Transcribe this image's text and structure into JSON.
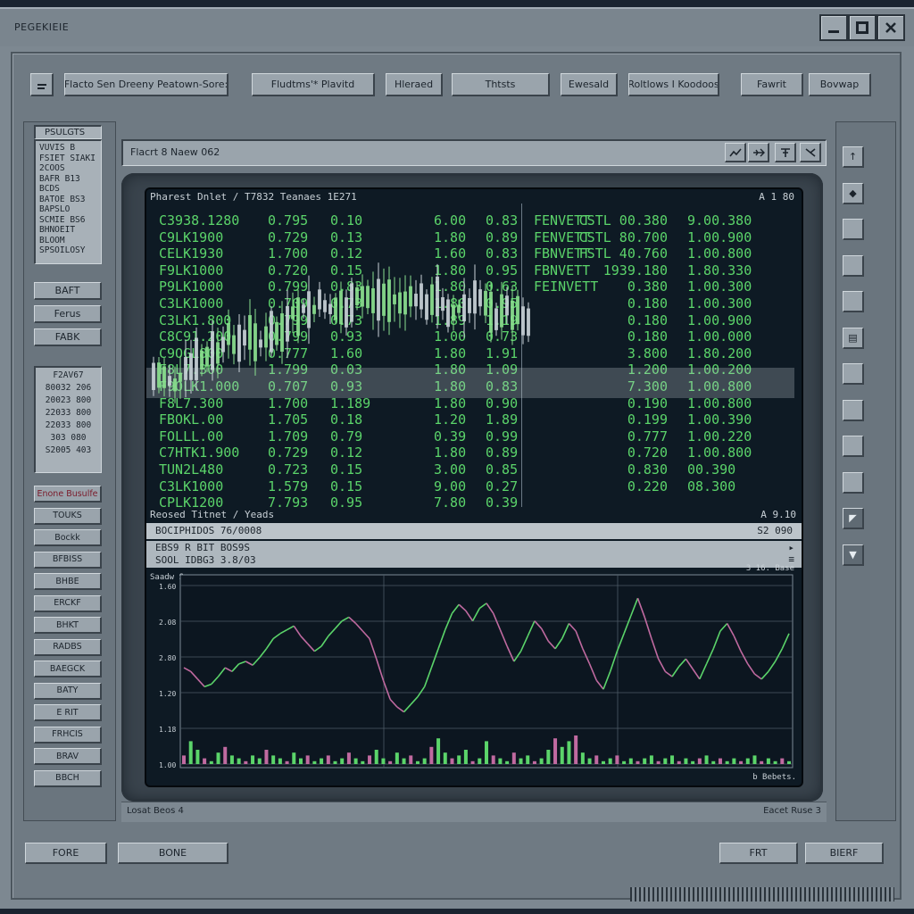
{
  "window": {
    "title": "PEGEKIEIE",
    "controls": [
      "minimize-icon",
      "maximize-icon",
      "close-icon"
    ]
  },
  "toolbar": {
    "icon_button": "menu-icon",
    "buttons": [
      "Flacto Sen Dreeny Peatown-Sore:",
      "Fludtms'* Plavitd",
      "Hleraed",
      "Thtsts",
      "Ewesald",
      "Roltlows I Koodoos",
      "Fawrit",
      "Bovwap"
    ]
  },
  "left_panel": {
    "list_title": "PSULGTS",
    "list_lines": [
      "VUVIS  B",
      "FSIET  SIAKI",
      "2COOS",
      "BAFR  B13",
      "BCDS",
      "BATOE  BS3",
      "BAPSLO",
      "SCMIE  BS6",
      "BHNOEIT",
      "BLOOM",
      "SPSOILOSY"
    ],
    "buttons_a": [
      "BAFT",
      "Ferus",
      "FABK"
    ],
    "value_title": "F2AV67",
    "value_lines": [
      "80032  206",
      "20023  800",
      "22033  800",
      "22033  800",
      "303  080",
      "S2005  403"
    ],
    "buttons_b": [
      "Enone Busulfe",
      "TOUKS",
      "Bockk",
      "BFBISS",
      "BHBE",
      "ERCKF",
      "BHKT",
      "RADBS",
      "BAEGCK",
      "BATY",
      "E RIT",
      "FRHCIS",
      "BRAV",
      "BBCH"
    ]
  },
  "right_panel": {
    "buttons": [
      "up-icon",
      "tag-icon",
      "blank",
      "blank",
      "blank",
      "doc-icon",
      "blank",
      "blank",
      "blank",
      "blank",
      "arrow-icon",
      "pin-icon"
    ]
  },
  "inner_toolbar": {
    "text": "Flacrt 8 Naew 062",
    "icons": [
      "chart-icon",
      "plane-icon",
      "pin-tool-icon",
      "mark-icon"
    ]
  },
  "screen_header": {
    "left": "Pharest Dnlet / T7832 Teanaes 1E271",
    "right": "A 1 80"
  },
  "left_table": [
    [
      "C3938.1280",
      "0.795",
      "0.10",
      "6.00",
      "0.83"
    ],
    [
      "C9LK1900",
      "0.729",
      "0.13",
      "1.80",
      "0.89"
    ],
    [
      "CELK1930",
      "1.700",
      "0.12",
      "1.60",
      "0.83"
    ],
    [
      "F9LK1000",
      "0.720",
      "0.15",
      "1.80",
      "0.95"
    ],
    [
      "P9LK1000",
      "0.799",
      "0.83",
      "1.80",
      "0.63"
    ],
    [
      "C3LK1000",
      "0.709",
      "0.73",
      "1.80",
      "0.95"
    ],
    [
      "C3LK1.800",
      "0.799",
      "0.73",
      "1.89",
      "1.19"
    ],
    [
      "C8C91.200",
      "0.799",
      "0.93",
      "1.00",
      "0.73"
    ],
    [
      "C9OGL800",
      "0.777",
      "1.60",
      "1.80",
      "1.91"
    ],
    [
      "F8L7.300",
      "1.799",
      "0.03",
      "1.80",
      "1.09"
    ],
    [
      "F9OLK1.000",
      "0.707",
      "0.93",
      "1.80",
      "0.83"
    ],
    [
      "F8L7.300",
      "1.700",
      "1.189",
      "1.80",
      "0.90"
    ],
    [
      "FBOKL.00",
      "1.705",
      "0.18",
      "1.20",
      "1.89"
    ],
    [
      "FOLLL.00",
      "1.709",
      "0.79",
      "0.39",
      "0.99"
    ],
    [
      "C7HTK1.900",
      "0.729",
      "0.12",
      "1.80",
      "0.89"
    ],
    [
      "TUN2L480",
      "0.723",
      "0.15",
      "3.00",
      "0.85"
    ],
    [
      "C3LK1000",
      "1.579",
      "0.15",
      "9.00",
      "0.27"
    ],
    [
      "CPLK1200",
      "7.793",
      "0.95",
      "7.80",
      "0.39"
    ]
  ],
  "right_table": [
    [
      "FENVETT",
      "CSTL 00.380",
      "9.00.380"
    ],
    [
      "FENVETT",
      "CSTL 80.700",
      "1.00.900"
    ],
    [
      "FBNVETT",
      "FSTL 40.760",
      "1.00.800"
    ],
    [
      "FBNVETT",
      "1939.180",
      "1.80.330"
    ],
    [
      "FEINVETT",
      "0.380",
      "1.00.300"
    ],
    [
      "",
      "0.180",
      "1.00.300"
    ],
    [
      "",
      "0.180",
      "1.00.900"
    ],
    [
      "",
      "0.180",
      "1.00.000"
    ],
    [
      "",
      "3.800",
      "1.80.200"
    ],
    [
      "",
      "1.200",
      "1.00.200"
    ],
    [
      "",
      "7.300",
      "1.00.800"
    ],
    [
      "",
      "0.190",
      "1.00.800"
    ],
    [
      "",
      "0.199",
      "1.00.390"
    ],
    [
      "",
      "0.777",
      "1.00.220"
    ],
    [
      "",
      "0.720",
      "1.00.800"
    ],
    [
      "",
      "0.830",
      "00.390"
    ],
    [
      "",
      "0.220",
      "08.300"
    ]
  ],
  "lower": {
    "title": "Reosed Titnet / Yeads",
    "title_right": "A 9.10",
    "row1_left": "BOCIPHIDOS  76/0008",
    "row1_right": "S2 090",
    "row2": "EBS9 R  BIT    BOS9S",
    "row3": "SOOL IDBG3    3.8/03",
    "chart_corner_left": "Saadw Sase",
    "chart_corner_right": "3 16. Base",
    "footer_right": "b Bebets."
  },
  "status": {
    "left": "Losat Beos 4",
    "right": "Eacet Ruse 3"
  },
  "bottom_buttons": {
    "left": [
      "FORE",
      "BONE"
    ],
    "right": [
      "FRT",
      "BIERF"
    ]
  },
  "chart_data": {
    "type": "line",
    "title": "",
    "ylabel": "",
    "y_ticks": [
      "1.60",
      "2.08",
      "2.80",
      "1.20",
      "1.18",
      "1.00"
    ],
    "values": [
      1.55,
      1.52,
      1.46,
      1.4,
      1.42,
      1.48,
      1.55,
      1.52,
      1.58,
      1.6,
      1.57,
      1.63,
      1.7,
      1.78,
      1.82,
      1.85,
      1.88,
      1.8,
      1.74,
      1.68,
      1.72,
      1.8,
      1.86,
      1.92,
      1.95,
      1.9,
      1.84,
      1.78,
      1.62,
      1.45,
      1.3,
      1.24,
      1.2,
      1.26,
      1.32,
      1.4,
      1.55,
      1.7,
      1.85,
      1.98,
      2.05,
      2.0,
      1.92,
      2.02,
      2.06,
      1.98,
      1.85,
      1.72,
      1.6,
      1.68,
      1.8,
      1.92,
      1.86,
      1.76,
      1.7,
      1.78,
      1.9,
      1.84,
      1.7,
      1.58,
      1.45,
      1.38,
      1.52,
      1.68,
      1.82,
      1.96,
      2.1,
      1.95,
      1.78,
      1.62,
      1.52,
      1.48,
      1.56,
      1.62,
      1.54,
      1.46,
      1.58,
      1.7,
      1.84,
      1.9,
      1.8,
      1.68,
      1.58,
      1.5,
      1.46,
      1.52,
      1.6,
      1.7,
      1.82
    ],
    "volumes": [
      0.3,
      0.8,
      0.5,
      0.2,
      0.1,
      0.4,
      0.6,
      0.3,
      0.2,
      0.1,
      0.3,
      0.2,
      0.5,
      0.3,
      0.2,
      0.1,
      0.4,
      0.2,
      0.3,
      0.1,
      0.2,
      0.3,
      0.1,
      0.2,
      0.4,
      0.2,
      0.1,
      0.3,
      0.5,
      0.2,
      0.1,
      0.4,
      0.2,
      0.3,
      0.1,
      0.2,
      0.6,
      0.9,
      0.4,
      0.2,
      0.3,
      0.5,
      0.1,
      0.2,
      0.8,
      0.3,
      0.2,
      0.1,
      0.4,
      0.2,
      0.3,
      0.1,
      0.2,
      0.5,
      0.9,
      0.6,
      0.8,
      1.0,
      0.4,
      0.2,
      0.3,
      0.1,
      0.2,
      0.3,
      0.1,
      0.2,
      0.1,
      0.2,
      0.3,
      0.1,
      0.2,
      0.3,
      0.1,
      0.2,
      0.1,
      0.2,
      0.3,
      0.1,
      0.2,
      0.1,
      0.2,
      0.1,
      0.2,
      0.3,
      0.1,
      0.2,
      0.1,
      0.2,
      0.1
    ]
  }
}
